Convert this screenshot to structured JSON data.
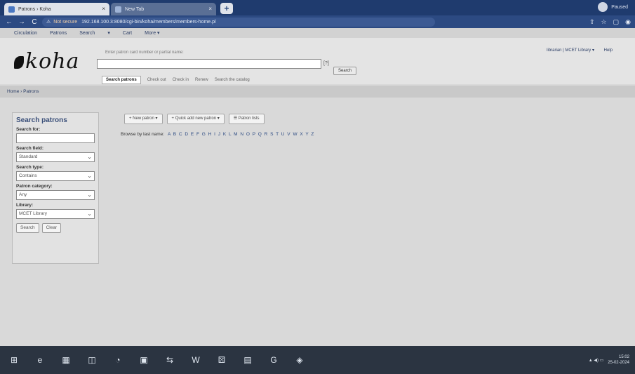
{
  "browser": {
    "tabs": [
      {
        "label": "Patrons › Koha",
        "close": "×"
      },
      {
        "label": "New Tab",
        "close": "×"
      }
    ],
    "new_tab": "+",
    "nav": {
      "back": "←",
      "forward": "→",
      "reload": "C"
    },
    "url_security": "Not secure",
    "url": "192.168.100.3:8080/cgi-bin/koha/members/members-home.pl",
    "actions": [
      "⇪",
      "☆",
      "▢",
      "◉"
    ],
    "profile": "Paused"
  },
  "koha": {
    "menu": [
      "Circulation",
      "Patrons",
      "Search",
      "▾",
      "Cart",
      "More ▾"
    ],
    "logo": "koha",
    "search_hint": "Enter patron card number or partial name:",
    "search_value": "",
    "help": "[?]",
    "submit": "Search",
    "tabs": [
      "Search patrons",
      "Check out",
      "Check in",
      "Renew",
      "Search the catalog"
    ],
    "login": "librarian | MCET Library ▾",
    "help_link": "Help"
  },
  "breadcrumbs": "Home › Patrons",
  "sidebar": {
    "title": "Search patrons",
    "search_for_label": "Search for:",
    "search_for_value": "",
    "search_field_label": "Search field:",
    "search_field_value": "Standard",
    "search_type_label": "Search type:",
    "search_type_value": "Contains",
    "patron_category_label": "Patron category:",
    "patron_category_value": "Any",
    "library_label": "Library:",
    "library_value": "MCET Library",
    "search_button": "Search",
    "clear_button": "Clear"
  },
  "toolbar": {
    "new_patron": "+ New patron ▾",
    "quick_add": "+ Quick add new patron ▾",
    "patron_lists": "☰ Patron lists"
  },
  "browse": {
    "label": "Browse by last name:",
    "letters": "A B C D E F G H I J K L M N O P Q R S T U V W X Y Z"
  },
  "taskbar": {
    "icons": [
      "⊞",
      "e",
      "▦",
      "◫",
      "◔",
      "▣",
      "⇆",
      "W",
      "⚄",
      "▤",
      "G",
      "◈"
    ],
    "tray": "▲ ◀) ▭",
    "time": "15:02",
    "date": "25-02-2024"
  }
}
